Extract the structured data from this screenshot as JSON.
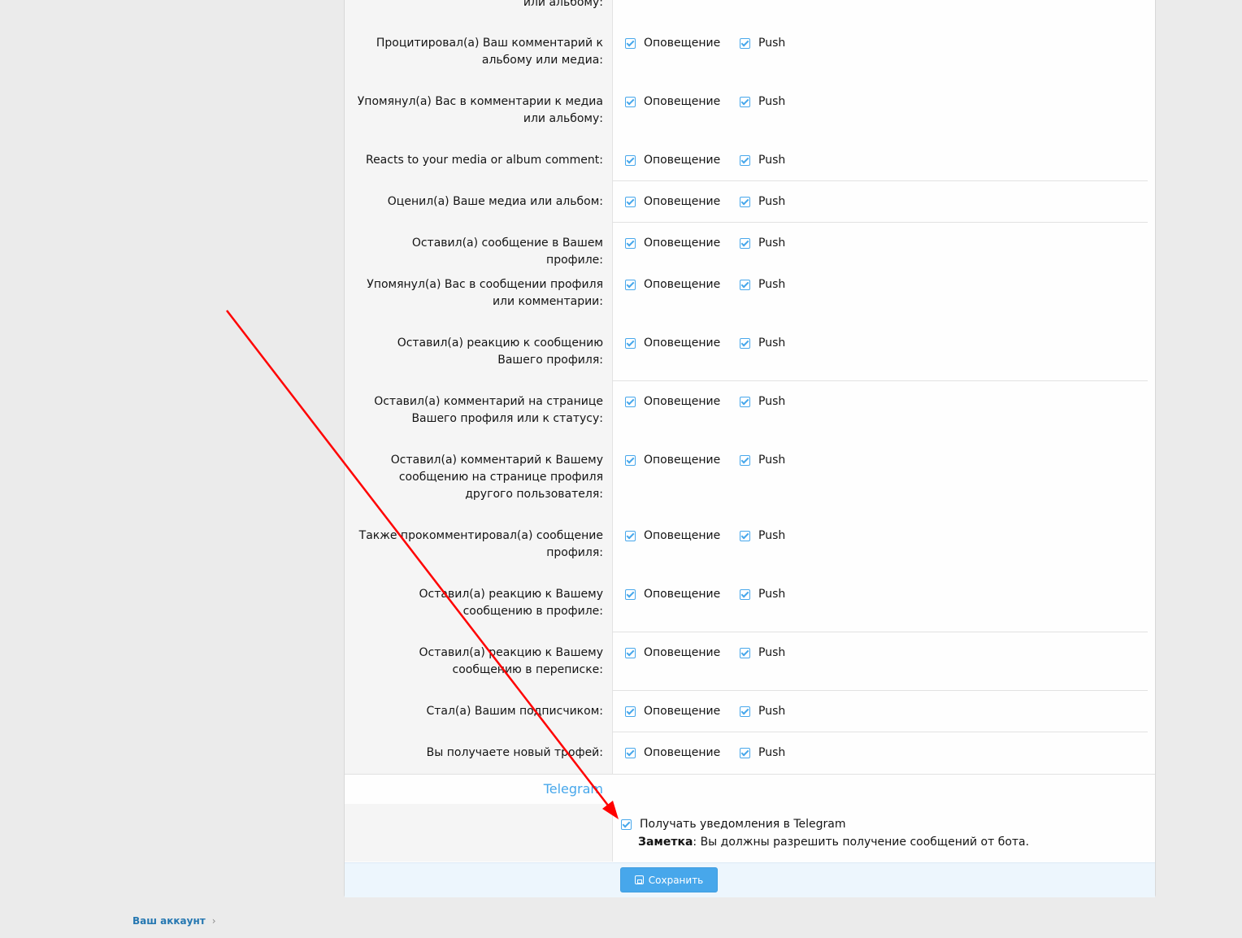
{
  "notifications": {
    "alert_label": "Оповещение",
    "push_label": "Push",
    "rows": [
      {
        "label": "или альбому:"
      },
      {
        "label": "Процитировал(а) Ваш комментарий к альбому или медиа:"
      },
      {
        "label": "Упомянул(а) Вас в комментарии к медиа или альбому:"
      },
      {
        "label": "Reacts to your media or album comment:"
      },
      {
        "label": "Оценил(а) Ваше медиа или альбом:"
      },
      {
        "label": "Оставил(а) сообщение в Вашем профиле:"
      },
      {
        "label": "Упомянул(а) Вас в сообщении профиля или комментарии:"
      },
      {
        "label": "Оставил(а) реакцию к сообщению Вашего профиля:"
      },
      {
        "label": "Оставил(а) комментарий на странице Вашего профиля или к статусу:"
      },
      {
        "label": "Оставил(а) комментарий к Вашему сообщению на странице профиля другого пользователя:"
      },
      {
        "label": "Также прокомментировал(а) сообщение профиля:"
      },
      {
        "label": "Оставил(а) реакцию к Вашему сообщению в профиле:"
      },
      {
        "label": "Оставил(а) реакцию к Вашему сообщению в переписке:"
      },
      {
        "label": "Стал(а) Вашим подписчиком:"
      },
      {
        "label": "Вы получаете новый трофей:"
      }
    ]
  },
  "telegram": {
    "section_title": "Telegram",
    "checkbox_label": "Получать уведомления в Telegram",
    "checked": true,
    "note_bold": "Заметка",
    "note_text": ": Вы должны разрешить получение сообщений от бота."
  },
  "footer": {
    "save_label": "Сохранить"
  },
  "breadcrumb": {
    "account_label": "Ваш аккаунт"
  },
  "colors": {
    "accent": "#47a7eb",
    "annotation_arrow": "#ff0000",
    "link": "#2577b1"
  }
}
